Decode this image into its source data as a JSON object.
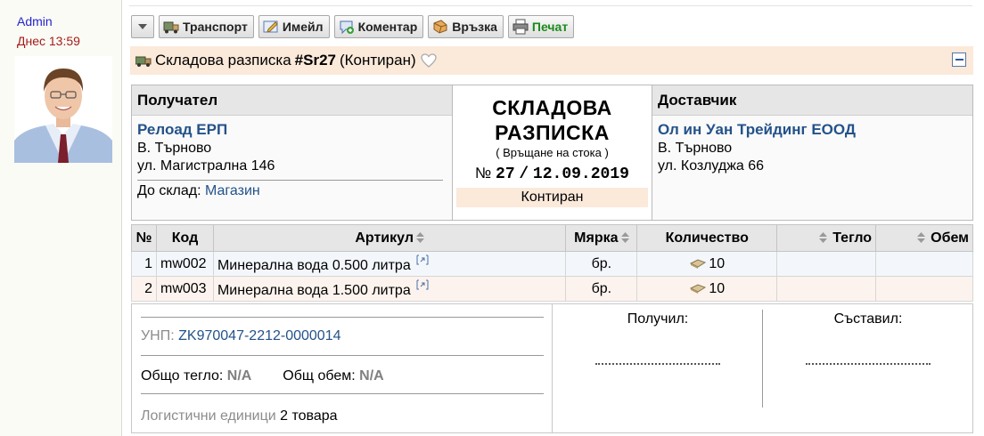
{
  "user": {
    "name": "Admin",
    "time": "Днес 13:59"
  },
  "toolbar": {
    "transport": "Транспорт",
    "email": "Имейл",
    "comment": "Коментар",
    "link": "Връзка",
    "print": "Печат"
  },
  "title": {
    "prefix": "Складова разписка",
    "number": "#Sr27",
    "status": "(Контиран)"
  },
  "recipient": {
    "header": "Получател",
    "name": "Релоад ЕРП",
    "city": "В. Търново",
    "address": "ул. Магистрална 146",
    "warehouse_label": "До склад:",
    "warehouse": "Магазин"
  },
  "document": {
    "title_line1": "СКЛАДОВА",
    "title_line2": "РАЗПИСКА",
    "subtitle": "( Връщане на стока )",
    "number_prefix": "№",
    "number": "27",
    "separator": "/",
    "date": "12.09.2019",
    "status": "Контиран"
  },
  "supplier": {
    "header": "Доставчик",
    "name": "Ол ин Уан Трейдинг ЕООД",
    "city": "В. Търново",
    "address": "ул. Козлуджа 66"
  },
  "table": {
    "headers": {
      "no": "№",
      "code": "Код",
      "article": "Артикул",
      "unit": "Мярка",
      "qty": "Количество",
      "weight": "Тегло",
      "volume": "Обем"
    },
    "rows": [
      {
        "no": "1",
        "code": "mw002",
        "article": "Минерална вода 0.500 литра",
        "unit": "бр.",
        "qty": "10"
      },
      {
        "no": "2",
        "code": "mw003",
        "article": "Минерална вода 1.500 литра",
        "unit": "бр.",
        "qty": "10"
      }
    ]
  },
  "footer": {
    "unp_label": "УНП:",
    "unp": "ZK970047-2212-0000014",
    "weight_label": "Общо тегло:",
    "weight_value": "N/A",
    "volume_label": "Общ обем:",
    "volume_value": "N/A",
    "logistic_label": "Логистични единици",
    "logistic_value": "2 товара",
    "received": "Получил:",
    "compiled": "Съставил:"
  }
}
